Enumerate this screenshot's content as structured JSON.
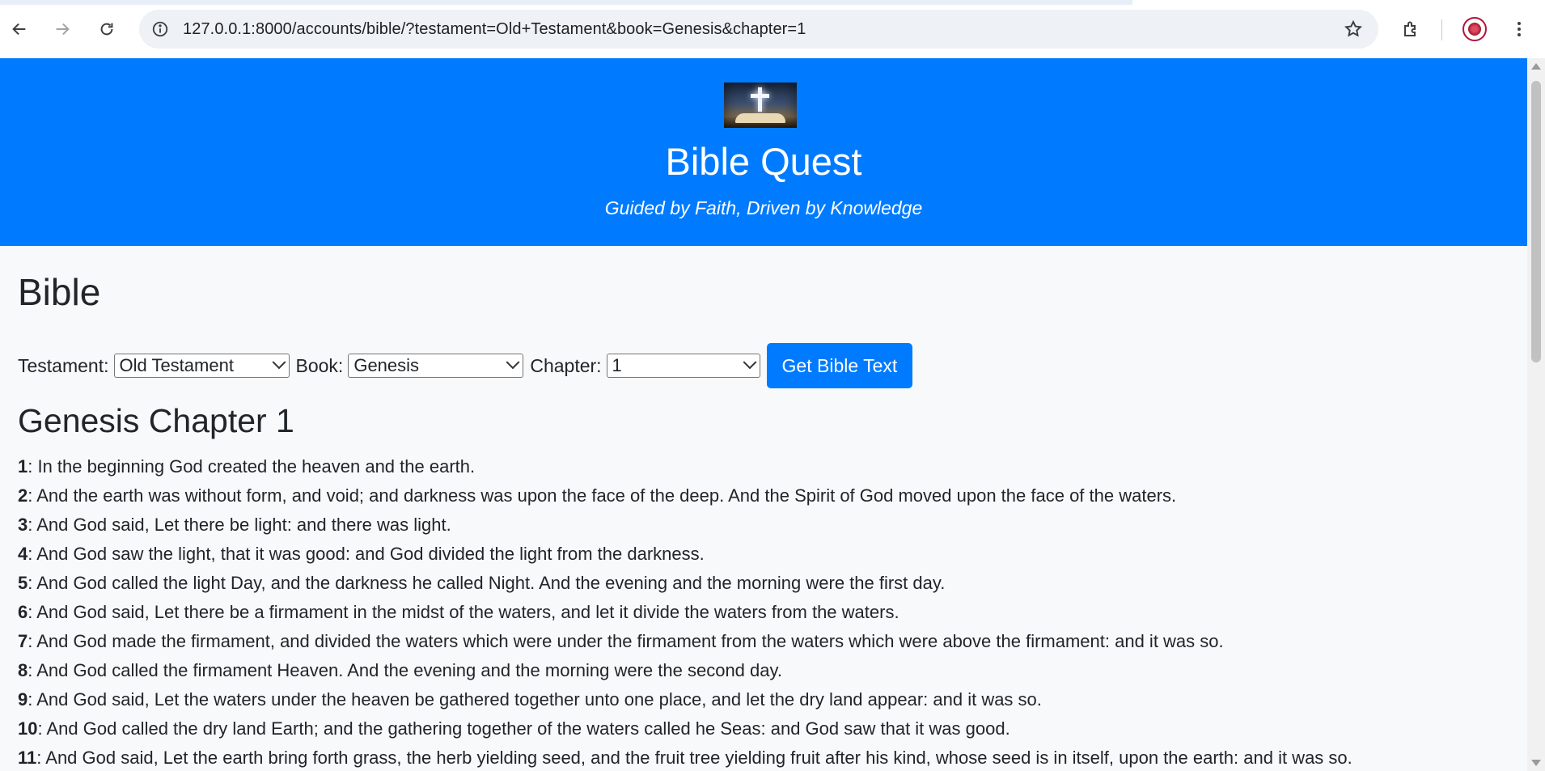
{
  "browser": {
    "url": "127.0.0.1:8000/accounts/bible/?testament=Old+Testament&book=Genesis&chapter=1"
  },
  "header": {
    "title": "Bible Quest",
    "tagline": "Guided by Faith, Driven by Knowledge"
  },
  "page": {
    "heading": "Bible",
    "filters": {
      "testament_label": "Testament:",
      "testament_value": "Old Testament",
      "book_label": "Book:",
      "book_value": "Genesis",
      "chapter_label": "Chapter:",
      "chapter_value": "1",
      "submit_label": "Get Bible Text"
    },
    "chapter_heading": "Genesis Chapter 1",
    "verses": [
      {
        "num": "1",
        "text": ": In the beginning God created the heaven and the earth."
      },
      {
        "num": "2",
        "text": ": And the earth was without form, and void; and darkness was upon the face of the deep. And the Spirit of God moved upon the face of the waters."
      },
      {
        "num": "3",
        "text": ": And God said, Let there be light: and there was light."
      },
      {
        "num": "4",
        "text": ": And God saw the light, that it was good: and God divided the light from the darkness."
      },
      {
        "num": "5",
        "text": ": And God called the light Day, and the darkness he called Night. And the evening and the morning were the first day."
      },
      {
        "num": "6",
        "text": ": And God said, Let there be a firmament in the midst of the waters, and let it divide the waters from the waters."
      },
      {
        "num": "7",
        "text": ": And God made the firmament, and divided the waters which were under the firmament from the waters which were above the firmament: and it was so."
      },
      {
        "num": "8",
        "text": ": And God called the firmament Heaven. And the evening and the morning were the second day."
      },
      {
        "num": "9",
        "text": ": And God said, Let the waters under the heaven be gathered together unto one place, and let the dry land appear: and it was so."
      },
      {
        "num": "10",
        "text": ": And God called the dry land Earth; and the gathering together of the waters called he Seas: and God saw that it was good."
      },
      {
        "num": "11",
        "text": ": And God said, Let the earth bring forth grass, the herb yielding seed, and the fruit tree yielding fruit after his kind, whose seed is in itself, upon the earth: and it was so."
      }
    ]
  },
  "colors": {
    "accent": "#007bff",
    "page_background": "#f8f9fa",
    "text": "#212529"
  }
}
